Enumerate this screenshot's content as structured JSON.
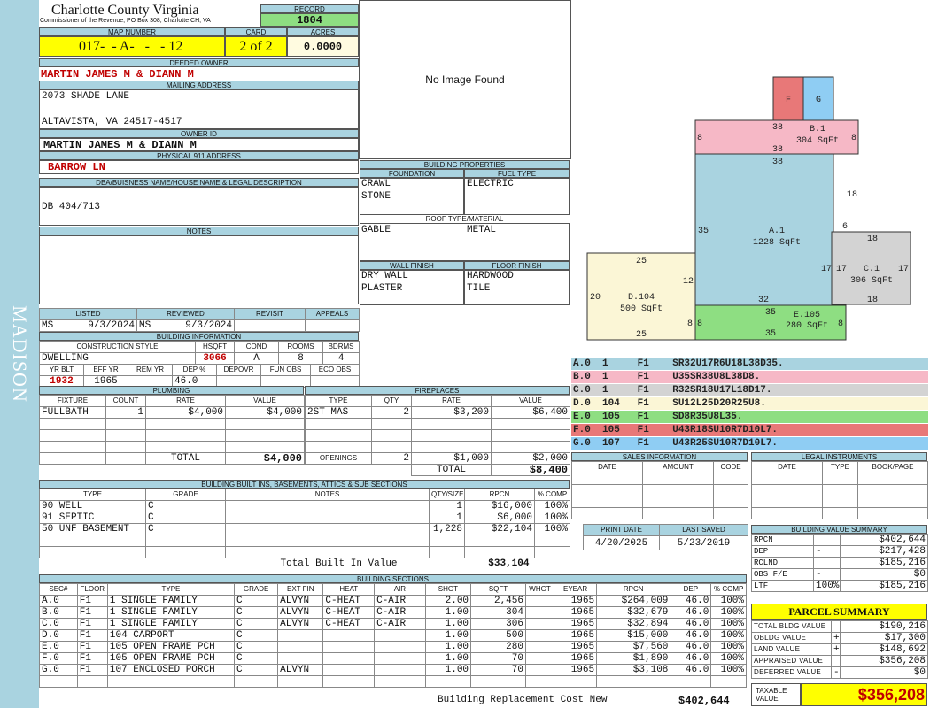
{
  "county": {
    "name": "Charlotte County Virginia",
    "address": "Commissioner of the Revenue, PO Box 308, Charlotte CH, VA"
  },
  "sidebar_label": "MADISON",
  "record": {
    "label": "RECORD",
    "value": "1804"
  },
  "map": {
    "label": "MAP NUMBER",
    "value": "017-  - A-   -   - 12"
  },
  "card": {
    "label": "CARD",
    "value": "2 of 2"
  },
  "acres": {
    "label": "ACRES",
    "value": "0.0000"
  },
  "owner": {
    "label": "DEEDED OWNER",
    "value": "MARTIN JAMES M & DIANN M"
  },
  "mailing": {
    "label": "MAILING ADDRESS",
    "line1": "2073 SHADE LANE",
    "line2": "ALTAVISTA, VA 24517-4517"
  },
  "owner_id": {
    "label": "OWNER ID",
    "value": "MARTIN JAMES M & DIANN M"
  },
  "physical": {
    "label": "PHYSICAL 911 ADDRESS",
    "value": "BARROW LN"
  },
  "legal": {
    "label": "DBA/BUISNESS NAME/HOUSE NAME & LEGAL DESCRIPTION",
    "value": "DB 404/713"
  },
  "notes": {
    "label": "NOTES"
  },
  "image": {
    "text": "No Image Found"
  },
  "listing": {
    "listed_label": "LISTED",
    "reviewed_label": "REVIEWED",
    "revisit_label": "REVISIT",
    "appeals_label": "APPEALS",
    "listed_by": "MS",
    "listed_date": "9/3/2024",
    "reviewed_by": "MS",
    "reviewed_date": "9/3/2024"
  },
  "bldg_info": {
    "title": "BUILDING INFORMATION",
    "style_label": "CONSTRUCTION STYLE",
    "hsqft_label": "HSQFT",
    "cond_label": "COND",
    "rooms_label": "ROOMS",
    "bdrms_label": "BDRMS",
    "style": "DWELLING",
    "hsqft": "3066",
    "cond": "A",
    "rooms": "8",
    "bdrms": "4",
    "yrblt_label": "YR BLT",
    "effyr_label": "EFF YR",
    "remyr_label": "REM YR",
    "dep_label": "DEP %",
    "depovr_label": "DEPOVR",
    "funobs_label": "FUN OBS",
    "ecoobs_label": "ECO OBS",
    "yrblt": "1932",
    "effyr": "1965",
    "remyr": "",
    "dep": "46.0"
  },
  "bldg_props": {
    "title": "BUILDING PROPERTIES",
    "foundation_label": "FOUNDATION",
    "fuel_label": "FUEL TYPE",
    "foundation": [
      "CRAWL",
      "STONE"
    ],
    "fuel": "ELECTRIC",
    "roof_label": "ROOF TYPE/MATERIAL",
    "roof_type": "GABLE",
    "roof_material": "METAL",
    "wall_label": "WALL FINISH",
    "floor_label": "FLOOR FINISH",
    "wall": [
      "DRY WALL",
      "PLASTER"
    ],
    "floor": [
      "HARDWOOD",
      "TILE"
    ]
  },
  "plumbing": {
    "title": "PLUMBING",
    "headers": [
      "FIXTURE",
      "COUNT",
      "RATE",
      "VALUE"
    ],
    "rows": [
      [
        "FULLBATH",
        "1",
        "$4,000",
        "$4,000"
      ]
    ],
    "total_label": "TOTAL",
    "total": "$4,000"
  },
  "fireplaces": {
    "title": "FIREPLACES",
    "headers": [
      "TYPE",
      "QTY",
      "RATE",
      "VALUE"
    ],
    "rows": [
      [
        "2ST MAS",
        "2",
        "$3,200",
        "$6,400"
      ]
    ],
    "openings_label": "OPENINGS",
    "openings": [
      "2",
      "$1,000",
      "$2,000"
    ],
    "total_label": "TOTAL",
    "total": "$8,400"
  },
  "builtins": {
    "title": "BUILDING BUILT INS, BASEMENTS, ATTICS & SUB SECTIONS",
    "headers": [
      "TYPE",
      "GRADE",
      "NOTES",
      "QTY/SIZE",
      "RPCN",
      "% COMP"
    ],
    "rows": [
      [
        "90 WELL",
        "C",
        "",
        "1",
        "$16,000",
        "100%"
      ],
      [
        "91 SEPTIC",
        "C",
        "",
        "1",
        "$6,000",
        "100%"
      ],
      [
        "50 UNF BASEMENT",
        "C",
        "",
        "1,228",
        "$22,104",
        "100%"
      ]
    ],
    "total_label": "Total Built In Value",
    "total": "$33,104"
  },
  "sections": {
    "title": "BUILDING SECTIONS",
    "headers": [
      "SEC#",
      "FLOOR",
      "TYPE",
      "GRADE",
      "EXT FIN",
      "HEAT",
      "AIR",
      "SHGT",
      "SQFT",
      "WHGT",
      "EYEAR",
      "RPCN",
      "DEP",
      "% COMP"
    ],
    "rows": [
      [
        "A.0",
        "F1",
        "1 SINGLE FAMILY",
        "C",
        "ALVYN",
        "C-HEAT",
        "C-AIR",
        "2.00",
        "2,456",
        "",
        "1965",
        "$264,009",
        "46.0",
        "100%"
      ],
      [
        "B.0",
        "F1",
        "1 SINGLE FAMILY",
        "C",
        "ALVYN",
        "C-HEAT",
        "C-AIR",
        "1.00",
        "304",
        "",
        "1965",
        "$32,679",
        "46.0",
        "100%"
      ],
      [
        "C.0",
        "F1",
        "1 SINGLE FAMILY",
        "C",
        "ALVYN",
        "C-HEAT",
        "C-AIR",
        "1.00",
        "306",
        "",
        "1965",
        "$32,894",
        "46.0",
        "100%"
      ],
      [
        "D.0",
        "F1",
        "104 CARPORT",
        "C",
        "",
        "",
        "",
        "1.00",
        "500",
        "",
        "1965",
        "$15,000",
        "46.0",
        "100%"
      ],
      [
        "E.0",
        "F1",
        "105 OPEN FRAME PCH",
        "C",
        "",
        "",
        "",
        "1.00",
        "280",
        "",
        "1965",
        "$7,560",
        "46.0",
        "100%"
      ],
      [
        "F.0",
        "F1",
        "105 OPEN FRAME PCH",
        "C",
        "",
        "",
        "",
        "1.00",
        "70",
        "",
        "1965",
        "$1,890",
        "46.0",
        "100%"
      ],
      [
        "G.0",
        "F1",
        "107 ENCLOSED PORCH",
        "C",
        "ALVYN",
        "",
        "",
        "1.00",
        "70",
        "",
        "1965",
        "$3,108",
        "46.0",
        "100%"
      ]
    ],
    "total_label": "Building Replacement Cost New",
    "total": "$402,644"
  },
  "sketch": {
    "rooms": [
      {
        "id": "F",
        "label": "F",
        "color": "#e87878"
      },
      {
        "id": "G",
        "label": "G",
        "color": "#8fcdf3"
      },
      {
        "id": "B",
        "label": "B.1",
        "area": "304 SqFt",
        "color": "#f6b8c6"
      },
      {
        "id": "A",
        "label": "A.1",
        "area": "1228 SqFt",
        "color": "#a9d3e0"
      },
      {
        "id": "C",
        "label": "C.1",
        "area": "306 SqFt",
        "color": "#d3d3d3"
      },
      {
        "id": "D",
        "label": "D.104",
        "area": "500 SqFt",
        "color": "#fbf6d6"
      },
      {
        "id": "E",
        "label": "E.105",
        "area": "280 SqFt",
        "color": "#8ede82"
      }
    ],
    "dims": [
      "38",
      "38",
      "38",
      "8",
      "8",
      "18",
      "6",
      "35",
      "18",
      "17",
      "17",
      "17",
      "18",
      "32",
      "25",
      "12",
      "20",
      "8",
      "25",
      "35",
      "8",
      "8",
      "35"
    ]
  },
  "vectors": [
    {
      "sec": "A.0",
      "n": "1",
      "fl": "F1",
      "v": "SR32U17R6U18L38D35.",
      "color": "#a9d3e0"
    },
    {
      "sec": "B.0",
      "n": "1",
      "fl": "F1",
      "v": "U35SR38U8L38D8.",
      "color": "#f6b8c6"
    },
    {
      "sec": "C.0",
      "n": "1",
      "fl": "F1",
      "v": "R32SR18U17L18D17.",
      "color": "#d3d3d3"
    },
    {
      "sec": "D.0",
      "n": "104",
      "fl": "F1",
      "v": "SU12L25D20R25U8.",
      "color": "#fbf6d6"
    },
    {
      "sec": "E.0",
      "n": "105",
      "fl": "F1",
      "v": "SD8R35U8L35.",
      "color": "#8ede82"
    },
    {
      "sec": "F.0",
      "n": "105",
      "fl": "F1",
      "v": "U43R18SU10R7D10L7.",
      "color": "#e87878"
    },
    {
      "sec": "G.0",
      "n": "107",
      "fl": "F1",
      "v": "U43R25SU10R7D10L7.",
      "color": "#8fcdf3"
    }
  ],
  "sales": {
    "title": "SALES INFORMATION",
    "headers": [
      "DATE",
      "AMOUNT",
      "CODE"
    ]
  },
  "legal_inst": {
    "title": "LEGAL INSTRUMENTS",
    "headers": [
      "DATE",
      "TYPE",
      "BOOK/PAGE"
    ]
  },
  "print": {
    "print_label": "PRINT DATE",
    "saved_label": "LAST SAVED",
    "print_date": "4/20/2025",
    "saved_date": "5/23/2019"
  },
  "value_summary": {
    "title": "BUILDING VALUE SUMMARY",
    "rows": [
      [
        "RPCN",
        "",
        "$402,644"
      ],
      [
        "DEP",
        "-",
        "$217,428"
      ],
      [
        "RCLND",
        "",
        "$185,216"
      ],
      [
        "OBS F/E",
        "-",
        "$0"
      ],
      [
        "LTF",
        "100%",
        "$185,216"
      ]
    ]
  },
  "parcel": {
    "title": "PARCEL SUMMARY",
    "rows": [
      [
        "TOTAL BLDG VALUE",
        "",
        "$190,216"
      ],
      [
        "OBLDG VALUE",
        "+",
        "$17,300"
      ],
      [
        "LAND VALUE",
        "+",
        "$148,692"
      ],
      [
        "APPRAISED VALUE",
        "",
        "$356,208"
      ],
      [
        "DEFERRED VALUE",
        "-",
        "$0"
      ]
    ],
    "taxable_label": "TAXABLE VALUE",
    "taxable": "$356,208"
  }
}
